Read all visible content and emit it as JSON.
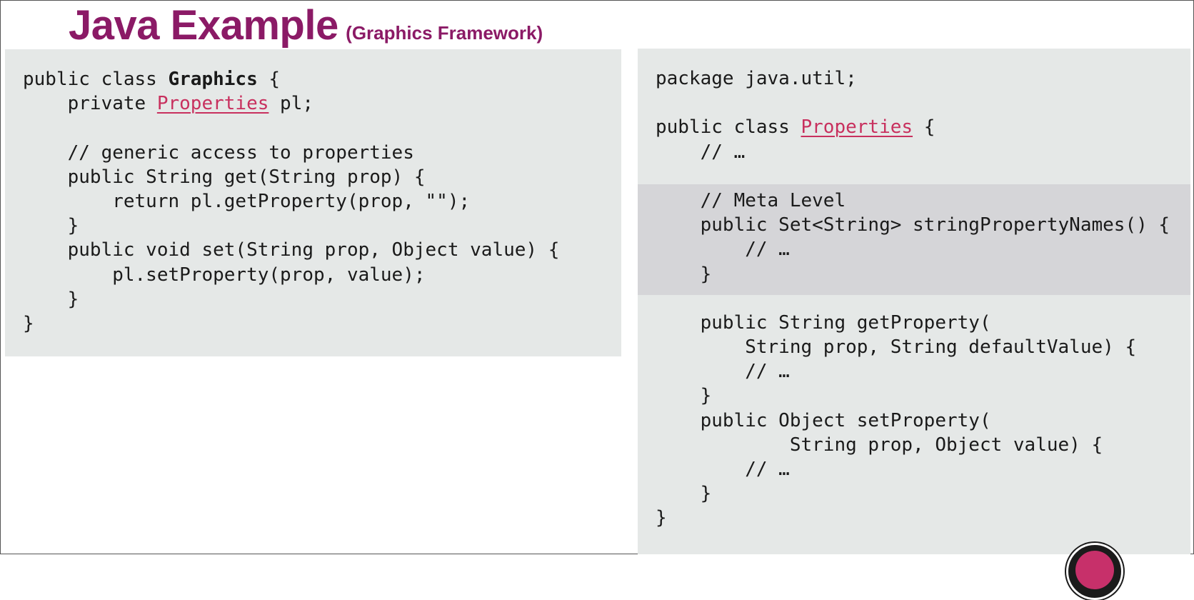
{
  "title": {
    "main": "Java Example",
    "sub": "(Graphics Framework)"
  },
  "code_left": {
    "l1_a": "public class ",
    "l1_b": "Graphics",
    "l1_c": " {",
    "l2_a": "    private ",
    "l2_link": "Properties",
    "l2_c": " pl;",
    "l3": "",
    "l4": "    // generic access to properties",
    "l5": "    public String get(String prop) {",
    "l6": "        return pl.getProperty(prop, \"\");",
    "l7": "    }",
    "l8": "    public void set(String prop, Object value) {",
    "l9": "        pl.setProperty(prop, value);",
    "l10": "    }",
    "l11": "}"
  },
  "code_right": {
    "l1": "package java.util;",
    "l2": "",
    "l3_a": "public class ",
    "l3_link": "Properties",
    "l3_c": " {",
    "l4": "    // …",
    "l5": "",
    "l6": "    // Meta Level",
    "l7": "    public Set<String> stringPropertyNames() {",
    "l8": "        // …",
    "l9": "    }",
    "l10": "",
    "l11": "    public String getProperty(",
    "l12": "        String prop, String defaultValue) {",
    "l13": "        // …",
    "l14": "    }",
    "l15": "    public Object setProperty(",
    "l16": "            String prop, Object value) {",
    "l17": "        // …",
    "l18": "    }",
    "l19": "}"
  },
  "colors": {
    "accent": "#8b1a66",
    "link": "#c8305e",
    "panel": "#e5e8e7",
    "highlight": "#d5d5d8"
  },
  "logo": {
    "icon": "university-logo-icon"
  }
}
